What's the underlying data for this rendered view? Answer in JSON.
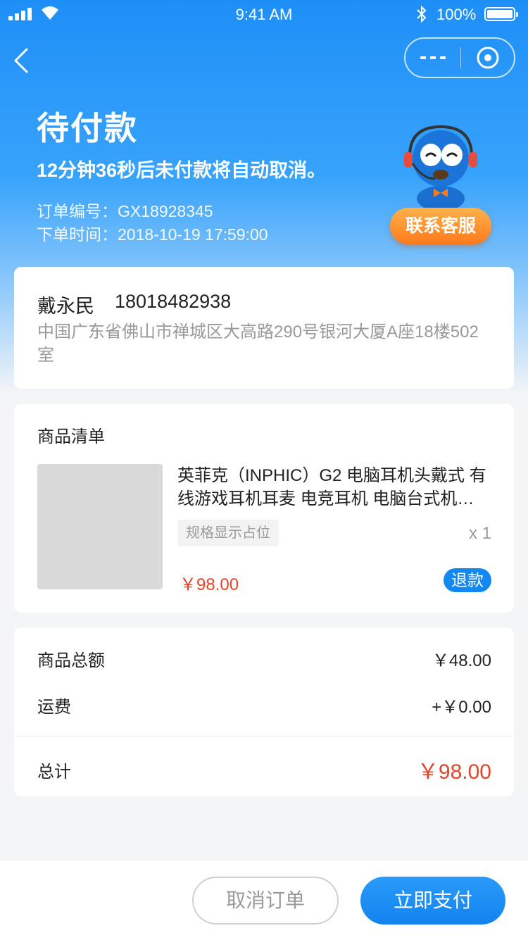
{
  "status_bar": {
    "time": "9:41 AM",
    "battery_percent": "100%"
  },
  "nav": {
    "back_icon": "chevron-left-icon",
    "more_icon": "more-icon",
    "close_icon": "close-circle-icon"
  },
  "header": {
    "title": "待付款",
    "countdown": "12分钟36秒后未付款将自动取消。",
    "order_no": "订单编号：GX18928345",
    "order_time": "下单时间：2018-10-19 17:59:00",
    "service_button": "联系客服",
    "mascot_icon": "customer-service-mascot-icon"
  },
  "address": {
    "name": "戴永民",
    "phone": "18018482938",
    "detail": "中国广东省佛山市禅城区大高路290号银河大厦A座18楼502室"
  },
  "items": {
    "section_title": "商品清单",
    "list": [
      {
        "name": "英菲克（INPHIC）G2 电脑耳机头戴式 有线游戏耳机耳麦 电竞耳机 电脑台式机…",
        "spec": "规格显示占位",
        "qty": "x 1",
        "price": "￥98.00",
        "refund_label": "退款"
      }
    ]
  },
  "summary": {
    "goods_total_label": "商品总额",
    "goods_total_value": "￥48.00",
    "shipping_label": "运费",
    "shipping_value": "+￥0.00",
    "total_label": "总计",
    "total_value": "￥98.00"
  },
  "actions": {
    "cancel": "取消订单",
    "pay": "立即支付"
  },
  "colors": {
    "primary": "#1e8ff7",
    "accent_orange": "#ff7a1c",
    "price_red": "#e4442c"
  }
}
